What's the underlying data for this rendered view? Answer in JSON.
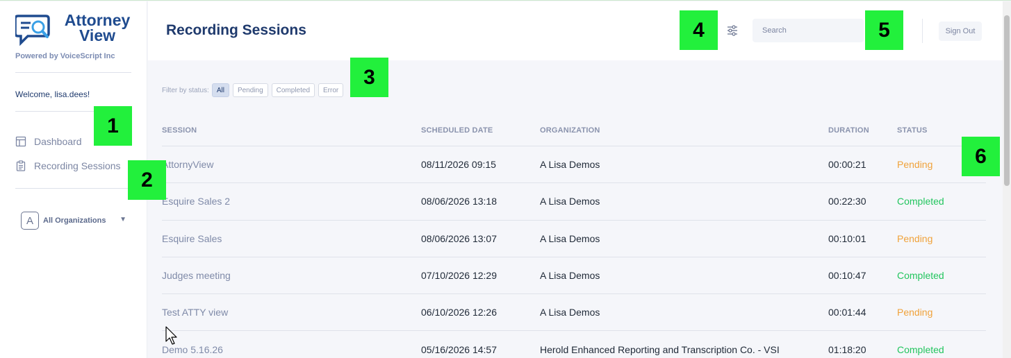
{
  "app": {
    "logo_text_line1": "Attorney",
    "logo_text_line2": "View",
    "powered_by": "Powered by VoiceScript Inc",
    "welcome": "Welcome, lisa.dees!"
  },
  "sidebar": {
    "items": [
      {
        "label": "Dashboard",
        "icon": "dashboard-icon"
      },
      {
        "label": "Recording Sessions",
        "icon": "clipboard-icon"
      }
    ],
    "org_selector": {
      "avatar_letter": "A",
      "label": "All Organizations",
      "caret": "▼"
    }
  },
  "header": {
    "title": "Recording Sessions",
    "search_placeholder": "Search",
    "sign_out_label": "Sign Out"
  },
  "filters": {
    "label": "Filter by status:",
    "options": [
      "All",
      "Pending",
      "Completed",
      "Error"
    ],
    "selected": "All"
  },
  "table": {
    "columns": [
      "SESSION",
      "SCHEDULED DATE",
      "ORGANIZATION",
      "DURATION",
      "STATUS"
    ],
    "rows": [
      {
        "session": "AttornyView",
        "date": "08/11/2026 09:15",
        "org": "A Lisa Demos",
        "duration": "00:00:21",
        "status": "Pending"
      },
      {
        "session": "Esquire Sales 2",
        "date": "08/06/2026 13:18",
        "org": "A Lisa Demos",
        "duration": "00:22:30",
        "status": "Completed"
      },
      {
        "session": "Esquire Sales",
        "date": "08/06/2026 13:07",
        "org": "A Lisa Demos",
        "duration": "00:10:01",
        "status": "Pending"
      },
      {
        "session": "Judges meeting",
        "date": "07/10/2026 12:29",
        "org": "A Lisa Demos",
        "duration": "00:10:47",
        "status": "Completed"
      },
      {
        "session": "Test ATTY view",
        "date": "06/10/2026 12:26",
        "org": "A Lisa Demos",
        "duration": "00:01:44",
        "status": "Pending"
      },
      {
        "session": "Demo 5.16.26",
        "date": "05/16/2026 14:57",
        "org": "Herold Enhanced Reporting and Transcription Co. - VSI",
        "duration": "01:18:20",
        "status": "Completed"
      }
    ]
  },
  "markers": [
    "1",
    "2",
    "3",
    "4",
    "5",
    "6"
  ],
  "colors": {
    "brand": "#1f4b8f",
    "pending": "#f0a23a",
    "completed": "#22c55e",
    "marker": "#22f03c"
  }
}
